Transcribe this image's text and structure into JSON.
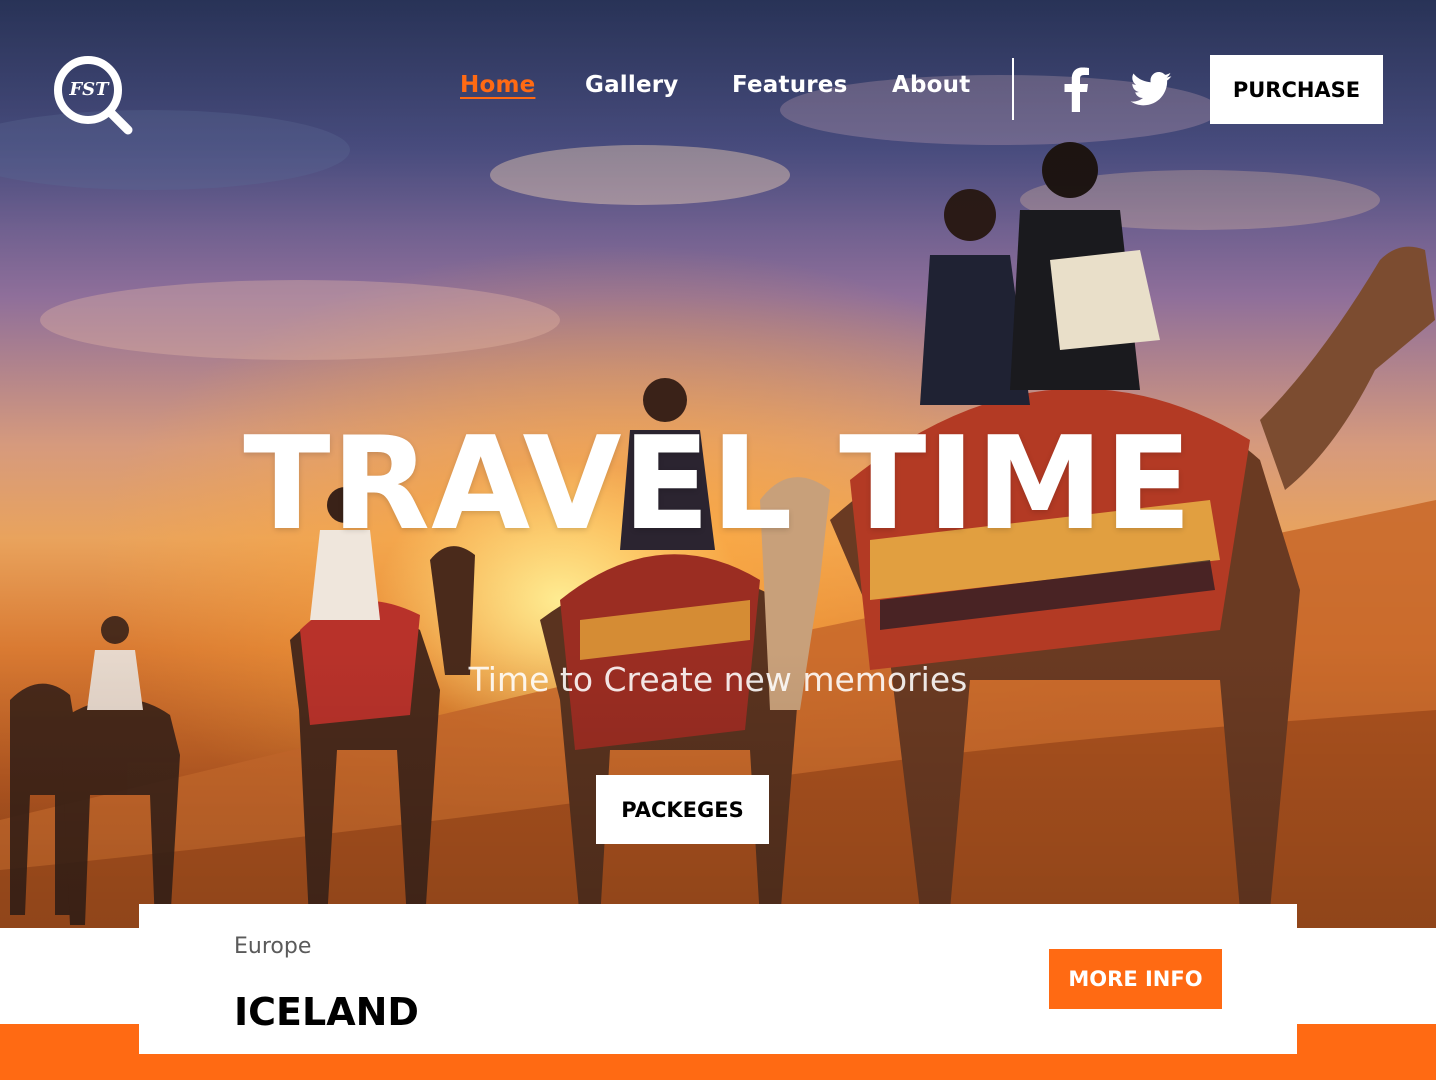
{
  "nav": {
    "links": [
      "Home",
      "Gallery",
      "Features",
      "About"
    ],
    "active": "Home",
    "purchase_label": "PURCHASE"
  },
  "logo": {
    "text": "FST",
    "icon": "magnifier-logo-icon"
  },
  "social": {
    "facebook_icon": "facebook-icon",
    "twitter_icon": "twitter-icon"
  },
  "hero": {
    "title": "TRAVEL TIME",
    "subtitle": "Time to Create new memories",
    "button_label": "PACKEGES"
  },
  "card": {
    "region": "Europe",
    "place": "ICELAND",
    "button_label": "MORE INFO"
  },
  "colors": {
    "accent": "#ff6a13",
    "white": "#ffffff",
    "text": "#000000"
  }
}
